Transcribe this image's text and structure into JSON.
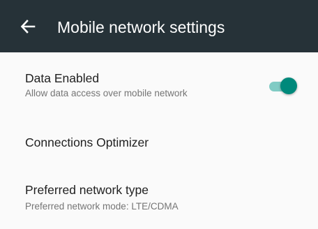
{
  "toolbar": {
    "title": "Mobile network settings",
    "back_icon": "arrow-left-icon",
    "background_color": "#263238"
  },
  "preferences": [
    {
      "title": "Data Enabled",
      "summary": "Allow data access over mobile network",
      "switch": {
        "checked": true,
        "accent_color": "#00897b"
      }
    },
    {
      "title": "Connections Optimizer"
    },
    {
      "title": "Preferred network type",
      "summary": "Preferred network mode: LTE/CDMA"
    }
  ]
}
